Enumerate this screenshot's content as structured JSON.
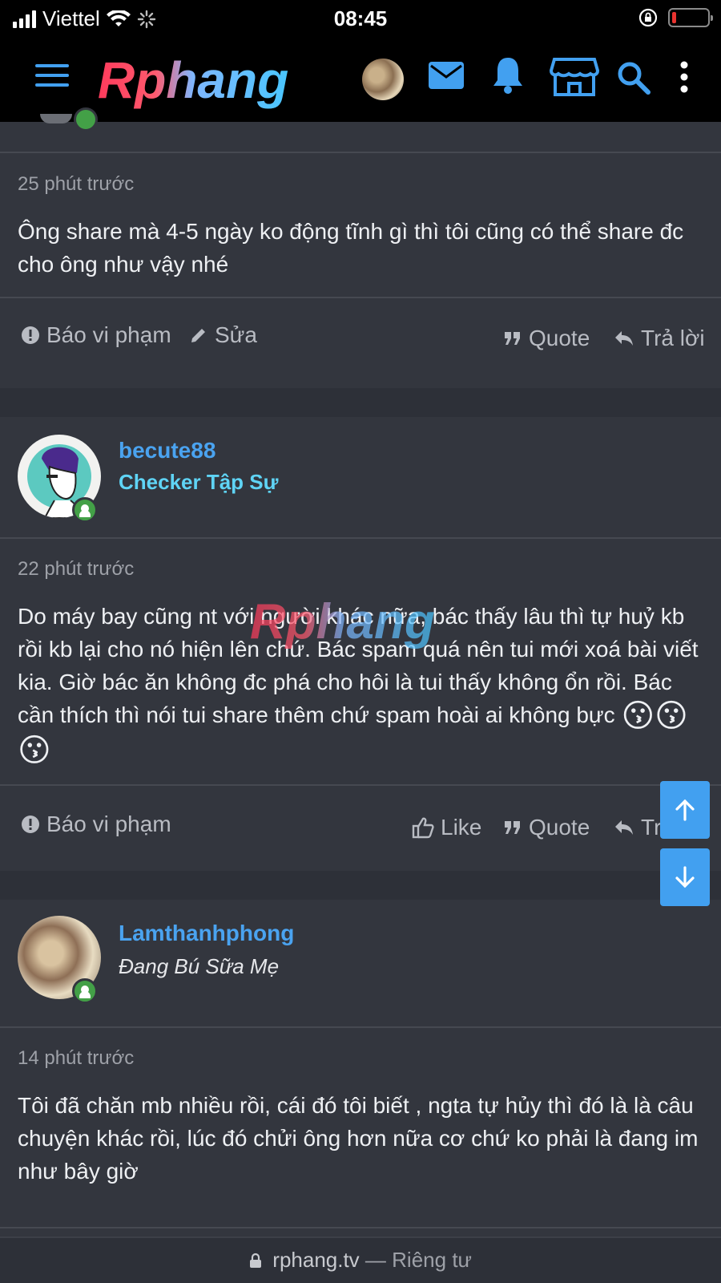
{
  "status_bar": {
    "carrier": "Viettel",
    "time": "08:45"
  },
  "header": {
    "logo_text": "Rphang",
    "icons": [
      "menu-icon",
      "avatar",
      "mail-icon",
      "bell-icon",
      "store-icon",
      "search-icon",
      "more-vertical-icon"
    ]
  },
  "posts": [
    {
      "time": "25 phút trước",
      "text": "Ông share mà 4-5 ngày ko động tĩnh gì thì tôi cũng có thể share đc cho ông như vậy nhé",
      "actions": {
        "report": "Báo vi phạm",
        "edit": "Sửa",
        "quote": "Quote",
        "reply": "Trả lời"
      }
    },
    {
      "username": "becute88",
      "user_title": "Checker Tập Sự",
      "time": "22 phút trước",
      "text": "Do máy bay cũng nt với người khác nữa, bác thấy lâu thì tự huỷ kb rồi kb lại cho nó hiện lên chứ. Bác spam quá nên tui mới xoá bài viết kia. Giờ bác ăn không đc phá cho hôi là tui thấy không ổn rồi. Bác cần thích thì nói tui share thêm chứ spam hoài ai không bực",
      "emoji": "😗😗😗",
      "actions": {
        "report": "Báo vi phạm",
        "like": "Like",
        "quote": "Quote",
        "reply": "Trả lời"
      }
    },
    {
      "username": "Lamthanhphong",
      "user_title": "Đang Bú Sữa Mẹ",
      "time": "14 phút trước",
      "text": "Tôi đã chăn mb nhiều rồi, cái đó tôi biết , ngta tự hủy thì đó là là câu chuyện khác rồi, lúc đó chửi ông hơn nữa cơ chứ ko phải là đang im như bây giờ"
    }
  ],
  "watermark": "Rphang",
  "url_bar": {
    "domain": "rphang.tv",
    "separator": "—",
    "privacy": "Riêng tư"
  },
  "colors": {
    "accent": "#42a0f0",
    "username": "#4aa3f0",
    "checker_title": "#5fd4f5",
    "online": "#43a047",
    "background": "#2d3038",
    "card": "#33363e"
  }
}
